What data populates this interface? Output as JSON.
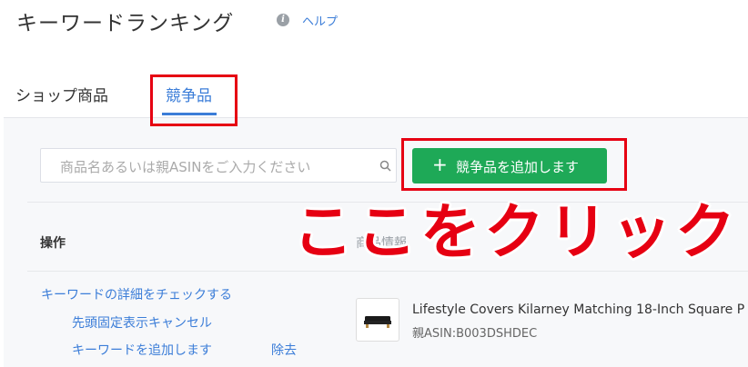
{
  "header": {
    "title": "キーワードランキング",
    "info_glyph": "i",
    "help_label": "ヘルプ"
  },
  "tabs": [
    {
      "label": "ショップ商品",
      "active": false
    },
    {
      "label": "競争品",
      "active": true
    }
  ],
  "toolbar": {
    "search_placeholder": "商品名あるいは親ASINをご入力ください",
    "add_button_label": "競争品を追加します",
    "add_button_icon": "+"
  },
  "table": {
    "columns": [
      "操作",
      "商品情報"
    ],
    "rows": [
      {
        "actions": {
          "check_details": "キーワードの詳細をチェックする",
          "cancel_pin": "先頭固定表示キャンセル",
          "add_keyword": "キーワードを追加します",
          "remove": "除去"
        },
        "product_title": "Lifestyle Covers Kilarney Matching 18-Inch Square P",
        "product_asin": "親ASIN:B003DSHDEC"
      }
    ]
  },
  "annotation": {
    "text": "ここをクリック"
  },
  "colors": {
    "accent": "#3b7dd8",
    "button": "#1ea957",
    "annotation": "#e60012"
  }
}
